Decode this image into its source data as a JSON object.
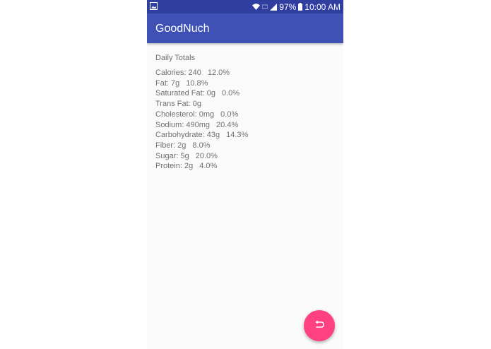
{
  "status_bar": {
    "battery": "97%",
    "time": "10:00 AM"
  },
  "app_bar": {
    "title": "GoodNuch"
  },
  "daily_totals": {
    "heading": "Daily Totals",
    "items": [
      {
        "label": "Calories: 240",
        "percent": "12.0%"
      },
      {
        "label": "Fat: 7g",
        "percent": "10.8%"
      },
      {
        "label": "Saturated Fat: 0g",
        "percent": "0.0%"
      },
      {
        "label": "Trans Fat: 0g",
        "percent": ""
      },
      {
        "label": "Cholesterol: 0mg",
        "percent": "0.0%"
      },
      {
        "label": "Sodium: 490mg",
        "percent": "20.4%"
      },
      {
        "label": "Carbohydrate: 43g",
        "percent": "14.3%"
      },
      {
        "label": "Fiber: 2g",
        "percent": "8.0%"
      },
      {
        "label": "Sugar: 5g",
        "percent": "20.0%"
      },
      {
        "label": "Protein: 2g",
        "percent": "4.0%"
      }
    ]
  },
  "fab": {
    "icon": "undo-icon"
  },
  "colors": {
    "status_bar": "#303f9f",
    "primary": "#3f51b5",
    "accent": "#ff4081",
    "background": "#fafafa",
    "text": "#707070"
  }
}
